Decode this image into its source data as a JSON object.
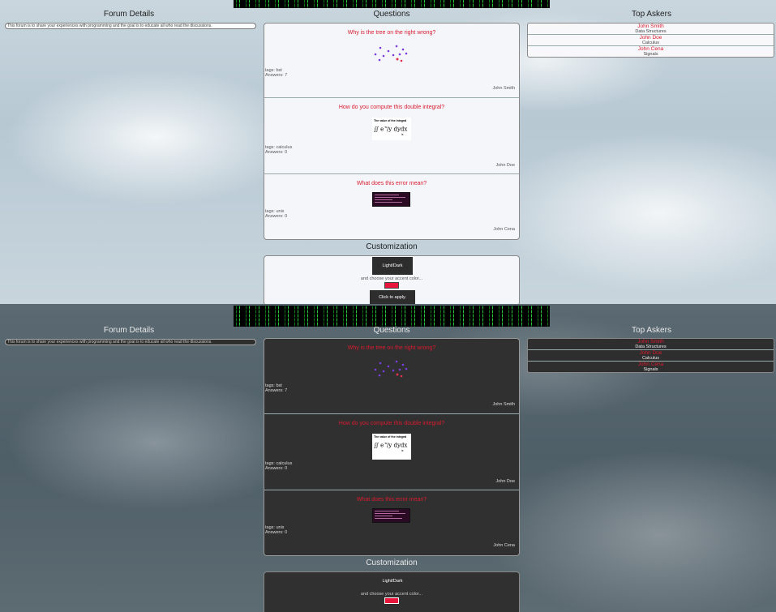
{
  "forum": {
    "title": "Forum Details",
    "description": "This forum is to share your experiences with programming and the goal is to educate all who read the discussions."
  },
  "questions": {
    "title": "Questions",
    "items": [
      {
        "title": "Why is the tree on the right wrong?",
        "tags": "tags: bst",
        "answers": "Answers: 7",
        "author": "John Smith"
      },
      {
        "title": "How do you compute this double integral?",
        "tags": "tags: calculus",
        "answers": "Answers: 0",
        "author": "John Doe"
      },
      {
        "title": "What does this error mean?",
        "tags": "tags: unix",
        "answers": "Answers: 0",
        "author": "John Cena"
      }
    ],
    "integral_caption": "The value of the integral",
    "integral_is": "is"
  },
  "askers": {
    "title": "Top Askers",
    "items": [
      {
        "name": "John Smith",
        "topic": "Data Structures"
      },
      {
        "name": "John Doe",
        "topic": "Calculus"
      },
      {
        "name": "John Cena",
        "topic": "Signals"
      }
    ]
  },
  "customization": {
    "title": "Customization",
    "toggle_label": "Light/Dark",
    "accent_text": "and choose your accent color...",
    "apply_label": "Click to apply.",
    "accent_color": "#e8163a"
  },
  "colors": {
    "accent": "#d91b2f"
  }
}
